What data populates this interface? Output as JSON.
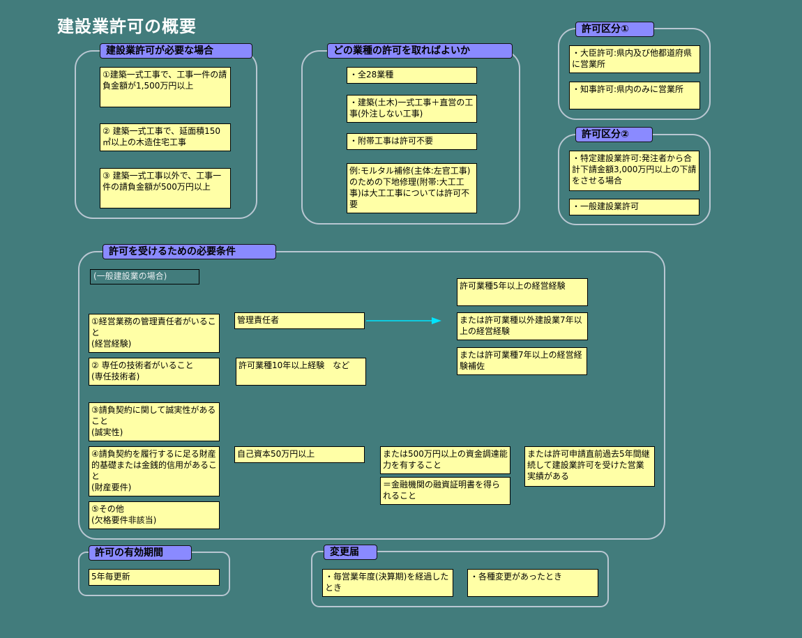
{
  "page_title": "建設業許可の概要",
  "required_cases": {
    "heading": "建設業許可が必要な場合",
    "items": [
      "①建築一式工事で、工事一件の請負金額が1,500万円以上",
      "② 建築一式工事で、延面積150㎡以上の木造住宅工事",
      "③ 建築一式工事以外で、工事一件の請負金額が500万円以上"
    ]
  },
  "trades": {
    "heading": "どの業種の許可を取ればよいか",
    "items": [
      "・全28業種",
      "・建築(土木)一式工事＋直営の工事(外注しない工事)",
      "・附帯工事は許可不要",
      "例:モルタル補修(主体:左官工事)のための下地修理(附帯:大工工事)は大工工事については許可不要"
    ]
  },
  "category1": {
    "heading": "許可区分①",
    "items": [
      "・大臣許可:県内及び他都道府県に営業所",
      "・知事許可:県内のみに営業所"
    ]
  },
  "category2": {
    "heading": "許可区分②",
    "items": [
      "・特定建設業許可:発注者から合計下請金額3,000万円以上の下請をさせる場合",
      "・一般建設業許可"
    ]
  },
  "requirements": {
    "heading": "許可を受けるための必要条件",
    "note": "(一般建設業の場合)",
    "cond1": "①経営業務の管理責任者がいること\n(経営経験)",
    "cond1_detail": "管理責任者",
    "cond1_options": [
      "許可業種5年以上の経営経験",
      "または許可業種以外建設業7年以上の経営経験",
      "または許可業種7年以上の経営経験補佐"
    ],
    "cond2": "② 専任の技術者がいること\n(専任技術者)",
    "cond2_detail": "許可業種10年以上経験　など",
    "cond3": "③請負契約に関して誠実性があること\n(誠実性)",
    "cond4": "④請負契約を履行するに足る財産的基礎または金銭的信用があること\n(財産要件)",
    "cond4_detail": "自己資本50万円以上",
    "cond4_alt1": "または500万円以上の資金調達能力を有すること",
    "cond4_alt1_note": "＝金融機関の融資証明書を得られること",
    "cond4_alt2": "または許可申請直前過去5年間継続して建設業許可を受けた営業実績がある",
    "cond5": "⑤その他\n(欠格要件非該当)"
  },
  "validity": {
    "heading": "許可の有効期間",
    "value": "5年毎更新"
  },
  "changes": {
    "heading": "変更届",
    "items": [
      "・毎営業年度(決算期)を経過したとき",
      "・各種変更があったとき"
    ]
  },
  "colors": {
    "background": "#427c7c",
    "box_fill": "#ffffa6",
    "heading_fill": "#8a8aff",
    "arrow": "#00e5ff"
  }
}
